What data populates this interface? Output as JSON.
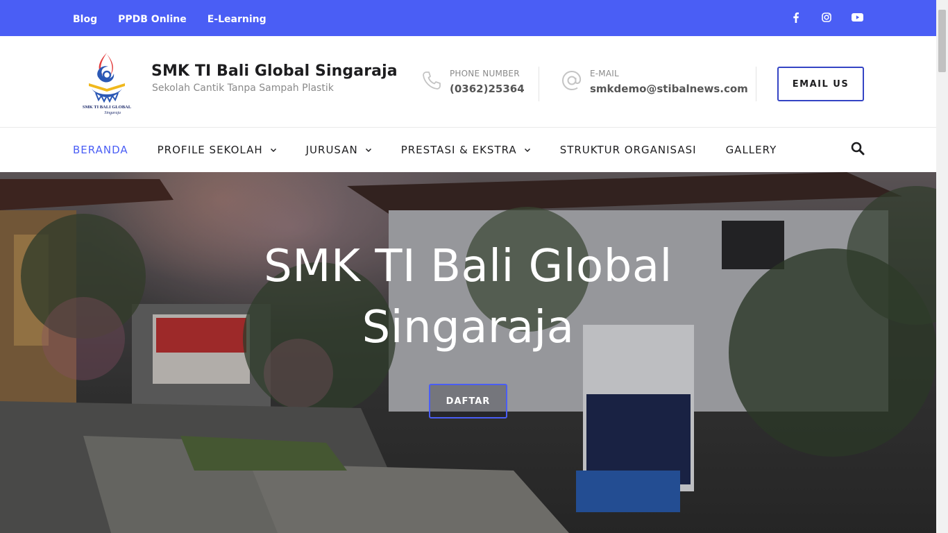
{
  "topbar": {
    "links": [
      "Blog",
      "PPDB Online",
      "E-Learning"
    ],
    "social": [
      "facebook-icon",
      "instagram-icon",
      "youtube-icon"
    ],
    "color": "#4a5ef5"
  },
  "brand": {
    "name": "SMK TI Bali Global Singaraja",
    "tagline": "Sekolah Cantik Tanpa Sampah Plastik",
    "logo_text": "SMK TI BALI GLOBAL",
    "logo_subtext": "Singaraja"
  },
  "contact": {
    "phone_label": "PHONE NUMBER",
    "phone_value": "(0362)25364",
    "email_label": "E-MAIL",
    "email_value": "smkdemo@stibalnews.com"
  },
  "header": {
    "email_button": "EMAIL US"
  },
  "nav": {
    "items": [
      {
        "label": "BERANDA",
        "active": true,
        "dropdown": false
      },
      {
        "label": "PROFILE SEKOLAH",
        "active": false,
        "dropdown": true
      },
      {
        "label": "JURUSAN",
        "active": false,
        "dropdown": true
      },
      {
        "label": "PRESTASI & EKSTRA",
        "active": false,
        "dropdown": true
      },
      {
        "label": "STRUKTUR ORGANISASI",
        "active": false,
        "dropdown": false
      },
      {
        "label": "GALLERY",
        "active": false,
        "dropdown": false
      }
    ],
    "search_icon": "search-icon"
  },
  "hero": {
    "title_line1": "SMK TI Bali Global",
    "title_line2": "Singaraja",
    "button": "DAFTAR",
    "accent": "#4a5ef5"
  }
}
